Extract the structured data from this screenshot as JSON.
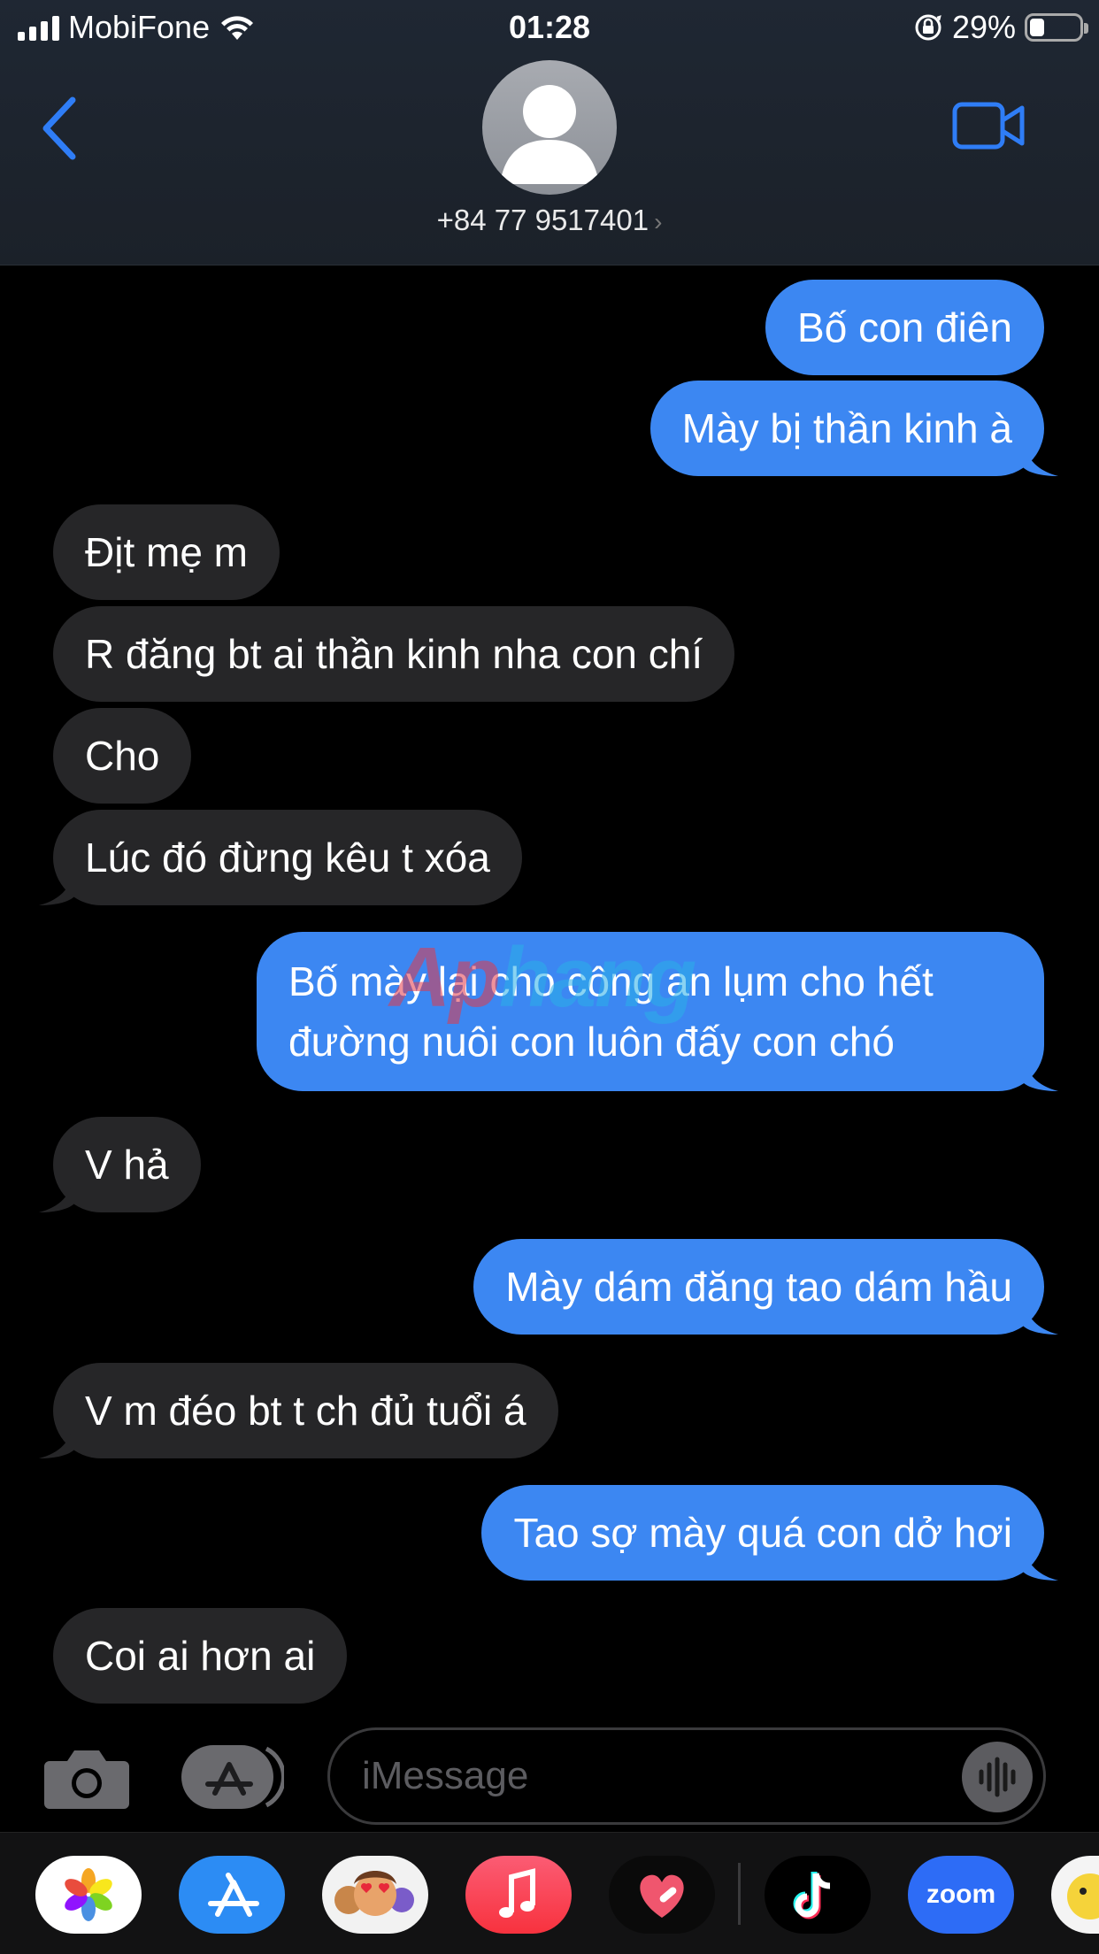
{
  "status_bar": {
    "carrier": "MobiFone",
    "time": "01:28",
    "battery_percent": "29%",
    "battery_level": 0.29
  },
  "header": {
    "contact": "+84 77 9517401",
    "chevron": "›"
  },
  "messages": [
    {
      "side": "out",
      "text": "Bố con điên"
    },
    {
      "side": "out",
      "text": "Mày bị thần kinh à"
    },
    {
      "side": "in",
      "text": "Địt mẹ m"
    },
    {
      "side": "in",
      "text": "R đăng bt ai thần kinh nha con chí"
    },
    {
      "side": "in",
      "text": "Cho"
    },
    {
      "side": "in",
      "text": "Lúc đó đừng kêu t xóa"
    },
    {
      "side": "out",
      "text": "Bố mày lại cho công an lụm cho hết đường nuôi con luôn đấy con chó"
    },
    {
      "side": "in",
      "text": "V hả"
    },
    {
      "side": "out",
      "text": "Mày dám đăng tao dám hầu"
    },
    {
      "side": "in",
      "text": "V m đéo bt t ch đủ tuổi á"
    },
    {
      "side": "out",
      "text": "Tao sợ mày quá con dở hơi"
    },
    {
      "side": "in",
      "text": "Coi ai hơn ai"
    }
  ],
  "watermark": {
    "part1": "Ap",
    "part2": "hang"
  },
  "input": {
    "placeholder": "iMessage"
  },
  "colors": {
    "outgoing": "#3c87f2",
    "incoming": "#262628",
    "accent": "#2f7df6"
  },
  "apps": [
    "photos-icon",
    "app-store-icon",
    "memoji-icon",
    "music-icon",
    "health-icon",
    "tiktok-icon",
    "zoom-icon",
    "sticker-icon"
  ],
  "zoom_label": "zoom"
}
